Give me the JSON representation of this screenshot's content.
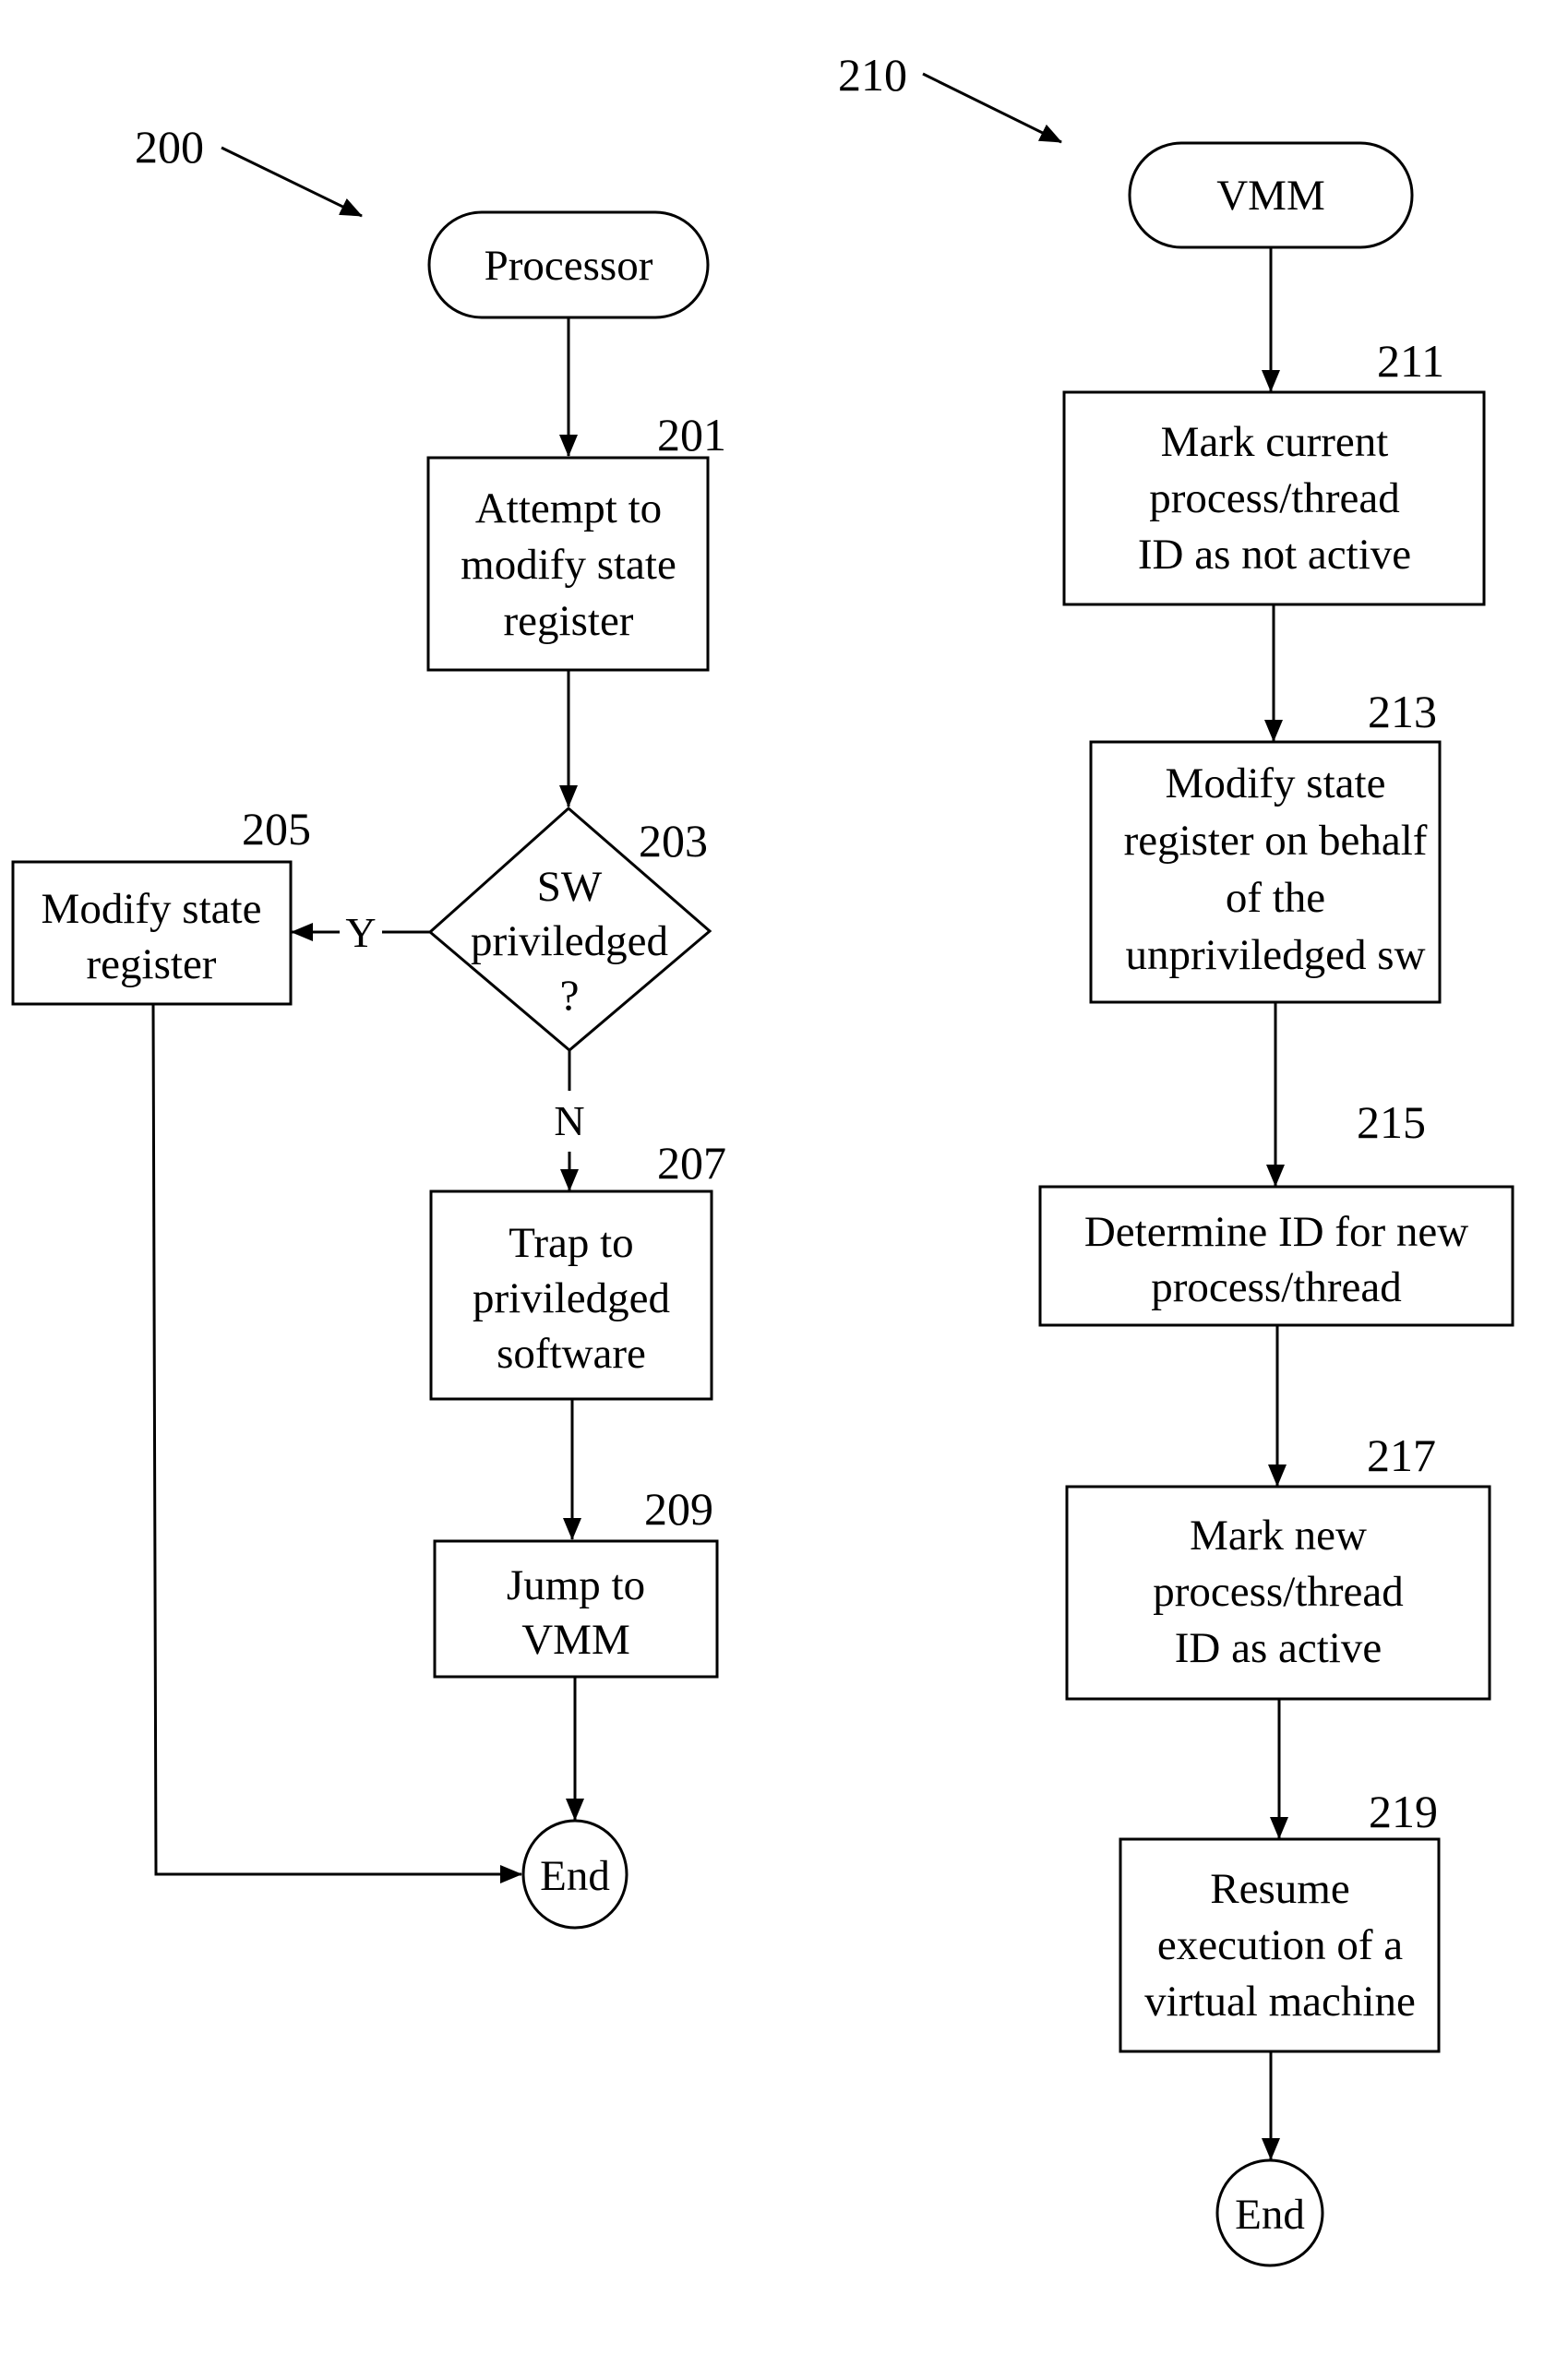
{
  "figure": {
    "left_flow": {
      "ref": "200",
      "start": {
        "label": "Processor"
      },
      "steps": {
        "s201": {
          "ref": "201",
          "lines": [
            "Attempt to",
            "modify state",
            "register"
          ]
        },
        "s203": {
          "ref": "203",
          "lines": [
            "SW",
            "priviledged",
            "?"
          ]
        },
        "s205": {
          "ref": "205",
          "lines": [
            "Modify state",
            "register"
          ]
        },
        "s207": {
          "ref": "207",
          "lines": [
            "Trap to",
            "priviledged",
            "software"
          ]
        },
        "s209": {
          "ref": "209",
          "lines": [
            "Jump to",
            "VMM"
          ]
        }
      },
      "yes_label": "Y",
      "no_label": "N",
      "end": {
        "label": "End"
      }
    },
    "right_flow": {
      "ref": "210",
      "start": {
        "label": "VMM"
      },
      "steps": {
        "s211": {
          "ref": "211",
          "lines": [
            "Mark current",
            "process/thread",
            "ID as not active"
          ]
        },
        "s213": {
          "ref": "213",
          "lines": [
            "Modify state",
            "register on behalf",
            "of the",
            "unpriviledged sw"
          ]
        },
        "s215": {
          "ref": "215",
          "lines": [
            "Determine ID for new",
            "process/thread"
          ]
        },
        "s217": {
          "ref": "217",
          "lines": [
            "Mark new",
            "process/thread",
            "ID as active"
          ]
        },
        "s219": {
          "ref": "219",
          "lines": [
            "Resume",
            "execution of a",
            "virtual machine"
          ]
        }
      },
      "end": {
        "label": "End"
      }
    }
  }
}
